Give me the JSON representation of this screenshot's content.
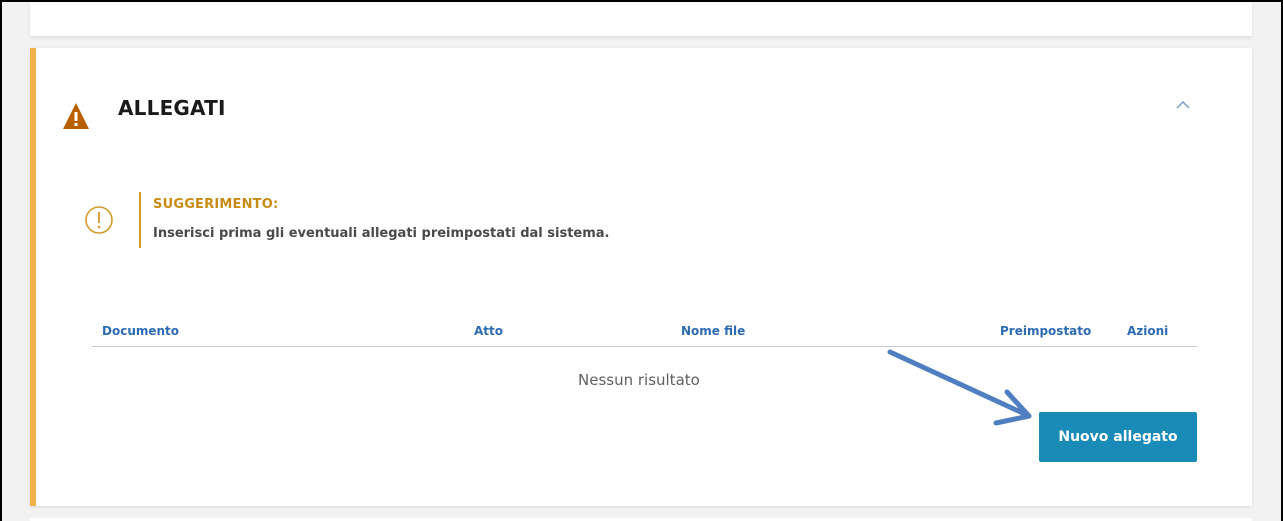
{
  "section": {
    "title": "ALLEGATI",
    "collapse_icon": "chevron-up-icon",
    "status_icon": "warning-triangle-icon"
  },
  "hint": {
    "icon": "exclamation-circle-icon",
    "title": "SUGGERIMENTO:",
    "text": "Inserisci prima gli eventuali allegati preimpostati dal sistema."
  },
  "table": {
    "columns": [
      "Documento",
      "Atto",
      "Nome file",
      "Preimpostato",
      "Azioni"
    ],
    "empty_message": "Nessun risultato"
  },
  "actions": {
    "new_attachment_label": "Nuovo allegato"
  },
  "colors": {
    "accent_bar": "#f1b24a",
    "warning_icon": "#b85f00",
    "hint_title": "#c98c12",
    "header_text": "#2d6bb2",
    "button_bg": "#1a8ab7",
    "annotation_arrow": "#4f7fc0"
  }
}
